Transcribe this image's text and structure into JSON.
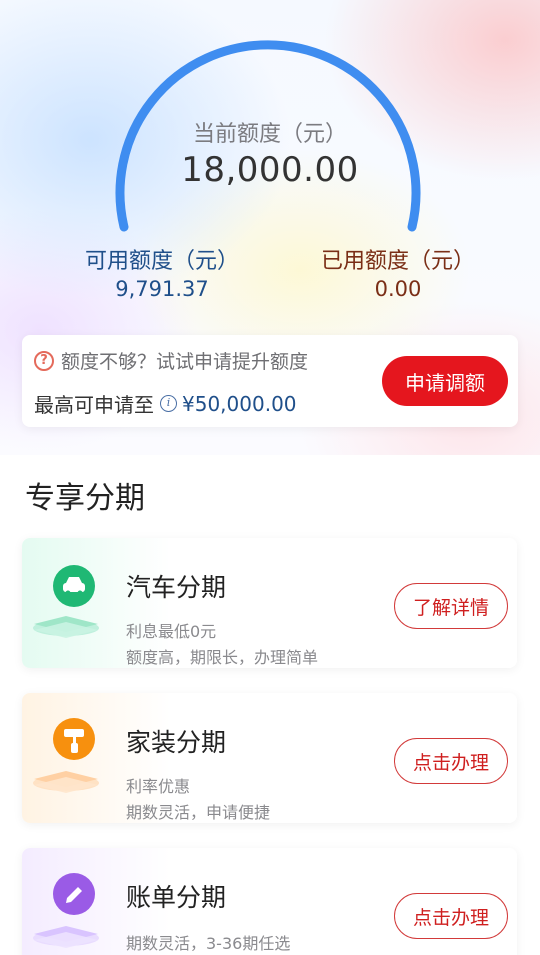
{
  "quota": {
    "current_label": "当前额度（元）",
    "current_value": "18,000.00",
    "available_label": "可用额度（元）",
    "available_value": "9,791.37",
    "used_label": "已用额度（元）",
    "used_value": "0.00",
    "available_fraction": 0.544
  },
  "raise": {
    "hint": "额度不够？试试申请提升额度",
    "max_label": "最高可申请至",
    "max_amount": "¥50,000.00",
    "button": "申请调额"
  },
  "section": {
    "title": "专享分期"
  },
  "products": [
    {
      "title": "汽车分期",
      "line1": "利息最低0元",
      "line2": "额度高，期限长，办理简单",
      "button": "了解详情",
      "icon": "car-icon",
      "color": "#21c07a"
    },
    {
      "title": "家装分期",
      "line1": "利率优惠",
      "line2": "期数灵活，申请便捷",
      "button": "点击办理",
      "icon": "paint-roller-icon",
      "color": "#f5940f"
    },
    {
      "title": "账单分期",
      "line1": "期数灵活，3-36期任选",
      "button": "点击办理",
      "icon": "pen-icon",
      "color": "#9b5de5"
    }
  ],
  "colors": {
    "accent_red": "#e5161e",
    "gauge_blue": "#3f8df0",
    "available_blue": "#1f4f8a",
    "used_brown": "#7a2e16"
  }
}
